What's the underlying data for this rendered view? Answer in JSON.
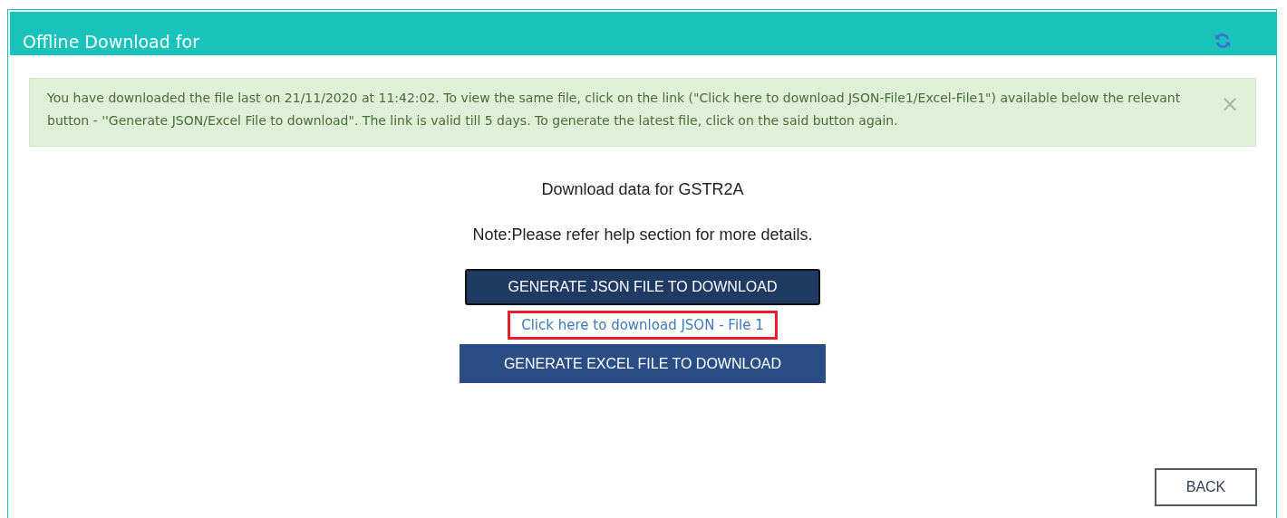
{
  "panel": {
    "title": "Offline Download for"
  },
  "alert": {
    "text": "You have downloaded the file last on 21/11/2020 at 11:42:02. To view the same file, click on the link (\"Click here to download JSON-File1/Excel-File1\") available below the relevant button - ''Generate JSON/Excel File to download\". The link is valid till 5 days. To generate the latest file, click on the said button again.",
    "close": "×"
  },
  "heading": "Download data for GSTR2A",
  "note": "Note:Please refer help section for more details.",
  "actions": [
    {
      "kind": "button",
      "label": "GENERATE JSON FILE TO DOWNLOAD",
      "focused": true
    },
    {
      "kind": "link",
      "label": "Click here to download JSON - File 1",
      "highlighted": true
    },
    {
      "kind": "button",
      "label": "GENERATE EXCEL FILE TO DOWNLOAD",
      "focused": false
    }
  ],
  "back_button": "BACK"
}
